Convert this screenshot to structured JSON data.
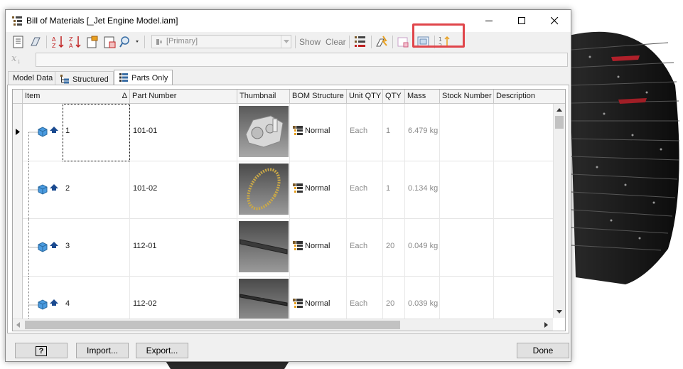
{
  "window": {
    "title": "Bill of Materials [_Jet Engine Model.iam]"
  },
  "toolbar": {
    "bom_view_value": "[Primary]",
    "show_label": "Show",
    "clear_label": "Clear",
    "icons": [
      "choose-for-display-icon",
      "export-bom-icon",
      "sort-descending-icon",
      "sort-ascending-icon",
      "item-override-icon",
      "renumber-items-icon",
      "find-icon",
      "bom-view-icon",
      "part-number-merge-icon",
      "zoom-icon",
      "thumbnail-icon",
      "thumbnail-settings-icon",
      "sort-items-icon"
    ]
  },
  "formula": {
    "icon": "formula-icon",
    "value": ""
  },
  "tabs": [
    {
      "label": "Model Data",
      "active": false
    },
    {
      "label": "Structured",
      "active": false
    },
    {
      "label": "Parts Only",
      "active": true
    }
  ],
  "grid": {
    "columns": [
      "Item",
      "Part Number",
      "Thumbnail",
      "BOM Structure",
      "Unit QTY",
      "QTY",
      "Mass",
      "Stock Number",
      "Description"
    ],
    "sort_indicator": "Δ",
    "rows": [
      {
        "item": "1",
        "part_number": "101-01",
        "thumbnail": "gearbox-assembly",
        "bom_structure": "Normal",
        "unit_qty": "Each",
        "qty": "1",
        "mass": "6.479 kg",
        "stock_number": "",
        "description": "",
        "selected": true
      },
      {
        "item": "2",
        "part_number": "101-02",
        "thumbnail": "ring-gear",
        "bom_structure": "Normal",
        "unit_qty": "Each",
        "qty": "1",
        "mass": "0.134 kg",
        "stock_number": "",
        "description": "",
        "selected": false
      },
      {
        "item": "3",
        "part_number": "112-01",
        "thumbnail": "blade-bar",
        "bom_structure": "Normal",
        "unit_qty": "Each",
        "qty": "20",
        "mass": "0.049 kg",
        "stock_number": "",
        "description": "",
        "selected": false
      },
      {
        "item": "4",
        "part_number": "112-02",
        "thumbnail": "notched-bar",
        "bom_structure": "Normal",
        "unit_qty": "Each",
        "qty": "20",
        "mass": "0.039 kg",
        "stock_number": "",
        "description": "",
        "selected": false
      }
    ]
  },
  "buttons": {
    "help": "?",
    "import": "Import...",
    "export": "Export...",
    "done": "Done"
  },
  "colors": {
    "highlight": "#e0454a",
    "part_icon": "#4a9be0"
  }
}
